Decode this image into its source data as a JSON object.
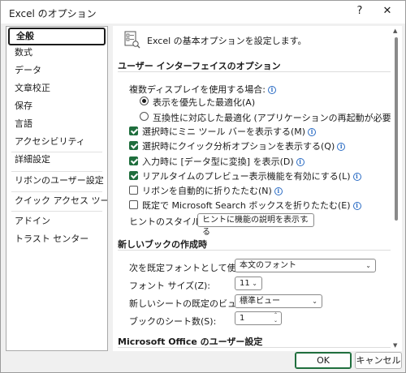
{
  "window": {
    "title": "Excel のオプション",
    "help_glyph": "?",
    "close_glyph": "✕"
  },
  "sidebar": {
    "items": [
      {
        "label": "全般",
        "selected": true
      },
      {
        "label": "数式"
      },
      {
        "label": "データ"
      },
      {
        "label": "文章校正"
      },
      {
        "label": "保存"
      },
      {
        "label": "言語"
      },
      {
        "label": "アクセシビリティ"
      },
      {
        "label": "詳細設定"
      },
      {
        "label": "リボンのユーザー設定"
      },
      {
        "label": "クイック アクセス ツール バー"
      },
      {
        "label": "アドイン"
      },
      {
        "label": "トラスト センター"
      }
    ]
  },
  "main": {
    "header": "Excel の基本オプションを設定します。",
    "ui_section": {
      "title": "ユーザー インターフェイスのオプション",
      "multi_display_label": "複数ディスプレイを使用する場合:",
      "radio_optimize_display": "表示を優先した最適化(A)",
      "radio_optimize_compat": "互換性に対応した最適化 (アプリケーションの再起動が必要)(C)",
      "check_mini_toolbar": "選択時にミニ ツール バーを表示する(M)",
      "check_quick_analysis": "選択時にクイック分析オプションを表示する(Q)",
      "check_data_type": "入力時に [データ型に変換] を表示(D)",
      "check_live_preview": "リアルタイムのプレビュー表示機能を有効にする(L)",
      "check_collapse_ribbon": "リボンを自動的に折りたたむ(N)",
      "check_collapse_search": "既定で Microsoft Search ボックスを折りたたむ(E)",
      "tooltip_style_label": "ヒントのスタイル(R):",
      "tooltip_style_value": "ヒントに機能の説明を表示する"
    },
    "new_workbook_section": {
      "title": "新しいブックの作成時",
      "default_font_label": "次を既定フォントとして使用(N):",
      "default_font_value": "本文のフォント",
      "font_size_label": "フォント サイズ(Z):",
      "font_size_value": "11",
      "default_view_label": "新しいシートの既定のビュー(V):",
      "default_view_value": "標準ビュー",
      "sheet_count_label": "ブックのシート数(S):",
      "sheet_count_value": "1"
    },
    "office_section": {
      "title": "Microsoft Office のユーザー設定"
    }
  },
  "footer": {
    "ok_label": "OK",
    "cancel_label": "キャンセル"
  },
  "colors": {
    "accent_green": "#1f6e3d",
    "info_blue": "#2b6cc4"
  },
  "icons": {
    "info": "info-icon",
    "options_header": "options-template-icon",
    "chevron": "chevron-down-icon"
  }
}
